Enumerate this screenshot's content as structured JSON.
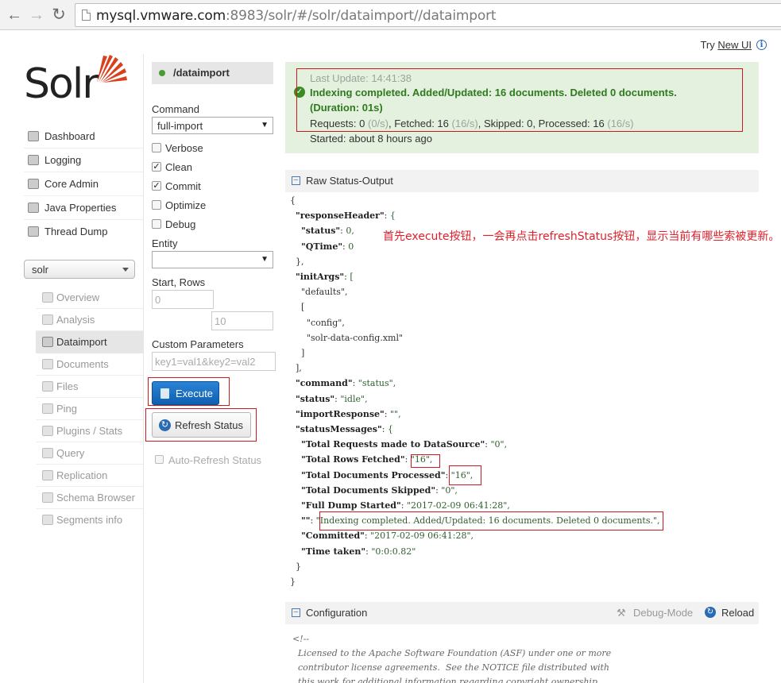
{
  "browser": {
    "url_host": "mysql.vmware.com",
    "url_rest": ":8983/solr/#/solr/dataimport//dataimport"
  },
  "top": {
    "try_label": "Try",
    "new_ui_label": "New UI"
  },
  "logo": {
    "text": "Solr"
  },
  "nav": {
    "items": [
      {
        "label": "Dashboard"
      },
      {
        "label": "Logging"
      },
      {
        "label": "Core Admin"
      },
      {
        "label": "Java Properties"
      },
      {
        "label": "Thread Dump"
      }
    ]
  },
  "core_selector": {
    "value": "solr"
  },
  "core_nav": {
    "items": [
      {
        "label": "Overview"
      },
      {
        "label": "Analysis"
      },
      {
        "label": "Dataimport"
      },
      {
        "label": "Documents"
      },
      {
        "label": "Files"
      },
      {
        "label": "Ping"
      },
      {
        "label": "Plugins / Stats"
      },
      {
        "label": "Query"
      },
      {
        "label": "Replication"
      },
      {
        "label": "Schema Browser"
      },
      {
        "label": "Segments info"
      }
    ]
  },
  "form": {
    "handler": "/dataimport",
    "command_label": "Command",
    "command_value": "full-import",
    "options": [
      {
        "label": "Verbose",
        "checked": false
      },
      {
        "label": "Clean",
        "checked": true
      },
      {
        "label": "Commit",
        "checked": true
      },
      {
        "label": "Optimize",
        "checked": false
      },
      {
        "label": "Debug",
        "checked": false
      }
    ],
    "entity_label": "Entity",
    "entity_value": "",
    "start_rows_label": "Start, Rows",
    "start_value": "0",
    "rows_value": "10",
    "custom_params_label": "Custom Parameters",
    "custom_params_value": "key1=val1&key2=val2",
    "execute_label": "Execute",
    "refresh_label": "Refresh Status",
    "auto_refresh_label": "Auto-Refresh Status"
  },
  "status": {
    "last_update": "Last Update: 14:41:38",
    "message_line1": "Indexing completed. Added/Updated: 16 documents. Deleted 0 documents.",
    "message_line2": "(Duration: 01s)",
    "req_label": "Requests: 0",
    "req_rate": "(0/s)",
    "fetched_label": ", Fetched: 16",
    "fetched_rate": "(16/s)",
    "skipped_processed": ", Skipped: 0, Processed: 16",
    "processed_rate": "(16/s)",
    "started": "Started: about 8 hours ago"
  },
  "raw_status": {
    "title": "Raw Status-Output",
    "lines": [
      {
        "t": "{"
      },
      {
        "t": "  \"responseHeader\": {"
      },
      {
        "t": "    \"status\": 0,"
      },
      {
        "t": "    \"QTime\": 0"
      },
      {
        "t": "  },"
      },
      {
        "t": "  \"initArgs\": ["
      },
      {
        "t": "    \"defaults\","
      },
      {
        "t": "    ["
      },
      {
        "t": "      \"config\","
      },
      {
        "t": "      \"solr-data-config.xml\""
      },
      {
        "t": "    ]"
      },
      {
        "t": "  ],"
      },
      {
        "t": "  \"command\": \"status\","
      },
      {
        "t": "  \"status\": \"idle\","
      },
      {
        "t": "  \"importResponse\": \"\","
      },
      {
        "t": "  \"statusMessages\": {"
      },
      {
        "t": "    \"Total Requests made to DataSource\": \"0\","
      },
      {
        "t": "    \"Total Rows Fetched\": \"16\","
      },
      {
        "t": "    \"Total Documents Processed\": \"16\","
      },
      {
        "t": "    \"Total Documents Skipped\": \"0\","
      },
      {
        "t": "    \"Full Dump Started\": \"2017-02-09 06:41:28\","
      },
      {
        "t": "    \"\": \"Indexing completed. Added/Updated: 16 documents. Deleted 0 documents.\","
      },
      {
        "t": "    \"Committed\": \"2017-02-09 06:41:28\","
      },
      {
        "t": "    \"Time taken\": \"0:0:0.82\""
      },
      {
        "t": "  }"
      },
      {
        "t": "}"
      }
    ]
  },
  "annotation": "首先execute按钮，一会再点击refreshStatus按钮，显示当前有哪些索被更新。",
  "configuration": {
    "title": "Configuration",
    "debug_mode_label": "Debug-Mode",
    "reload_label": "Reload",
    "body": "<!--\n  Licensed to the Apache Software Foundation (ASF) under one or more\n  contributor license agreements.  See the NOTICE file distributed with\n  this work for additional information regarding copyright ownership."
  },
  "colors": {
    "status_bg": "#e4f1df",
    "success_text": "#2f7a1e",
    "primary_button": "#1a6fc4",
    "annotation_red": "#e0202a"
  }
}
